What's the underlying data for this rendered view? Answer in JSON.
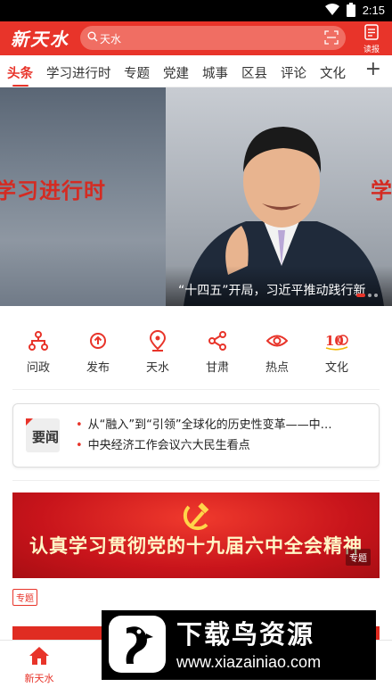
{
  "status_bar": {
    "time": "2:15"
  },
  "header": {
    "logo": "新天水",
    "search_placeholder": "天水",
    "reader_label": "读报"
  },
  "tabs": [
    {
      "label": "头条",
      "active": true
    },
    {
      "label": "学习进行时"
    },
    {
      "label": "专题"
    },
    {
      "label": "党建"
    },
    {
      "label": "城事"
    },
    {
      "label": "区县"
    },
    {
      "label": "评论"
    },
    {
      "label": "文化"
    }
  ],
  "tabs_more": "+",
  "banner": {
    "slogan": "学习进行时",
    "slogan_right": "学",
    "caption": "“十四五”开局，习近平推动践行新"
  },
  "quick_links": [
    {
      "label": "问政",
      "icon": "network-icon"
    },
    {
      "label": "发布",
      "icon": "upload-circle-icon"
    },
    {
      "label": "天水",
      "icon": "location-pin-icon"
    },
    {
      "label": "甘肃",
      "icon": "share-icon"
    },
    {
      "label": "热点",
      "icon": "eye-icon"
    },
    {
      "label": "文化",
      "icon": "culture-logo-icon"
    }
  ],
  "headlines": {
    "badge": "要闻",
    "items": [
      "从“融入”到“引领”全球化的历史性变革——中…",
      "中央经济工作会议六大民生看点"
    ]
  },
  "promo": {
    "title": "认真学习贯彻党的十九届六中全会精神",
    "tag": "专题",
    "badge": "专题"
  },
  "bottom_nav": [
    {
      "label": "新天水",
      "icon": "home-icon"
    }
  ],
  "watermark": {
    "title": "下载鸟资源",
    "url": "www.xiazainiao.com"
  },
  "colors": {
    "accent": "#e8342a",
    "header": "#e8342a"
  }
}
